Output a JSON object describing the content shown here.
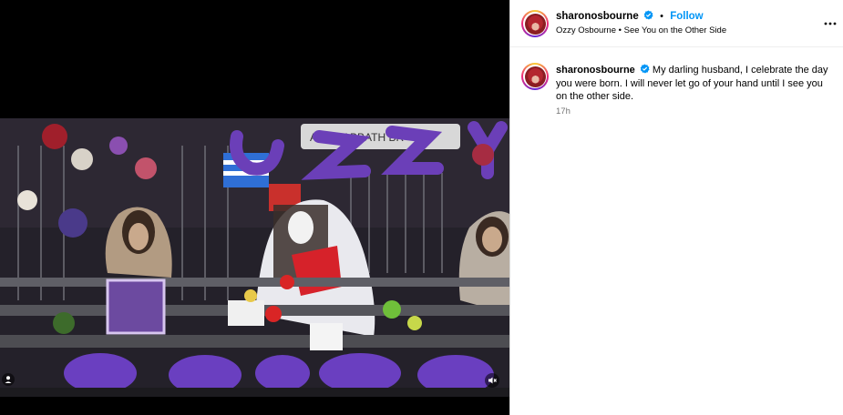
{
  "post": {
    "username": "sharonosbourne",
    "follow_label": "Follow",
    "separator": "•",
    "audio_label": "Ozzy Osbourne • See You on the Other Side",
    "caption": "My darling husband, I celebrate the day you were born. I will never let go of your hand until I see you on the other side.",
    "timestamp": "17h"
  },
  "media": {
    "sign_text": "ACK SABBATH BR"
  },
  "icons": {
    "verified": "verified-badge-icon",
    "more": "more-options-icon",
    "user_tag": "user-tag-icon",
    "mute": "speaker-muted-icon"
  },
  "colors": {
    "accent": "#0095f6",
    "verified": "#0095f6",
    "muted_text": "#737373",
    "flowers": "#6b3fb8"
  }
}
